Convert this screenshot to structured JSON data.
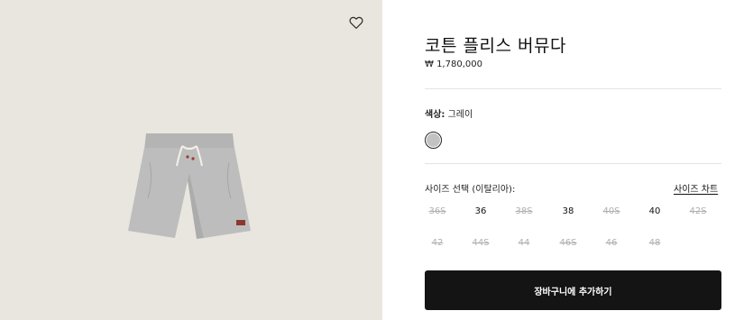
{
  "product": {
    "title": "코튼 플리스 버뮤다",
    "price": "₩ 1,780,000"
  },
  "color": {
    "label": "색상:",
    "value": "그레이",
    "swatch": "#c2c2c2"
  },
  "size": {
    "title": "사이즈 선택 (이탈리아):",
    "chart_link": "사이즈 차트",
    "options": [
      {
        "label": "36S",
        "available": false
      },
      {
        "label": "36",
        "available": true
      },
      {
        "label": "38S",
        "available": false
      },
      {
        "label": "38",
        "available": true
      },
      {
        "label": "40S",
        "available": false
      },
      {
        "label": "40",
        "available": true
      },
      {
        "label": "42S",
        "available": false
      },
      {
        "label": "42",
        "available": false
      },
      {
        "label": "44S",
        "available": false
      },
      {
        "label": "44",
        "available": false
      },
      {
        "label": "46S",
        "available": false
      },
      {
        "label": "46",
        "available": false
      },
      {
        "label": "48",
        "available": false
      }
    ]
  },
  "cart": {
    "label": "장바구니에 추가하기"
  },
  "icons": {
    "wishlist": "heart-outline-icon"
  }
}
